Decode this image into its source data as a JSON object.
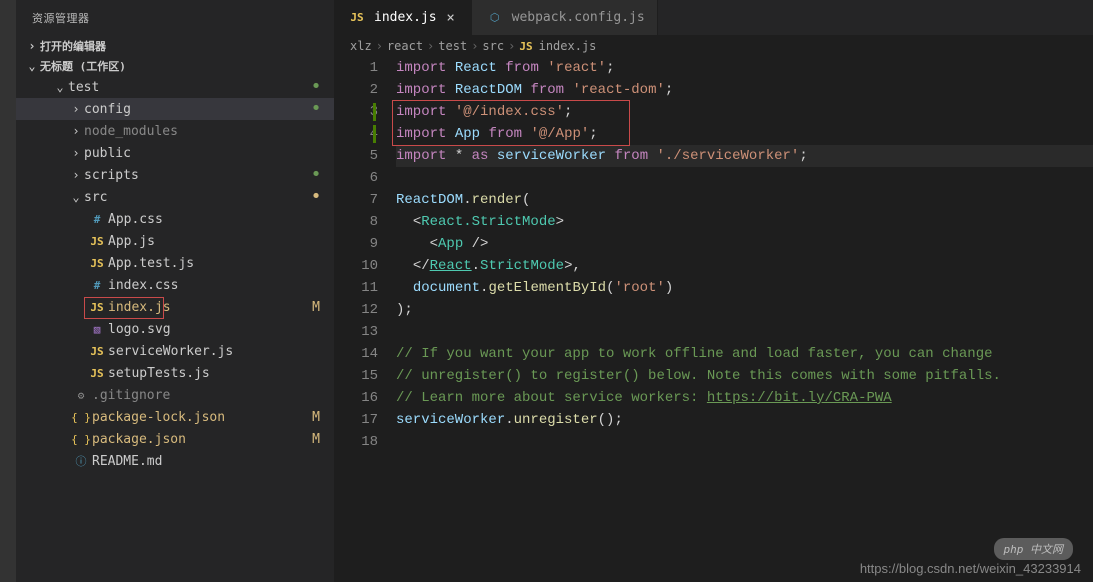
{
  "sidebar": {
    "title": "资源管理器",
    "sections": {
      "openEditors": "打开的编辑器",
      "workspace": "无标题 (工作区)"
    },
    "tree": {
      "root": "test",
      "folders": {
        "config": "config",
        "node_modules": "node_modules",
        "public": "public",
        "scripts": "scripts",
        "src": "src"
      },
      "srcFiles": {
        "appCss": "App.css",
        "appJs": "App.js",
        "appTestJs": "App.test.js",
        "indexCss": "index.css",
        "indexJs": "index.js",
        "logoSvg": "logo.svg",
        "serviceWorkerJs": "serviceWorker.js",
        "setupTestsJs": "setupTests.js"
      },
      "rootFiles": {
        "gitignore": ".gitignore",
        "packageLock": "package-lock.json",
        "packageJson": "package.json",
        "readme": "README.md"
      },
      "badges": {
        "modified": "M"
      }
    }
  },
  "tabs": {
    "indexJs": "index.js",
    "webpackConfig": "webpack.config.js"
  },
  "breadcrumbs": {
    "parts": [
      "xlz",
      "react",
      "test",
      "src",
      "index.js"
    ],
    "sep": "›"
  },
  "code": {
    "l1": {
      "kw1": "import",
      "var1": "React",
      "kw2": "from",
      "str": "'react'",
      "p": ";"
    },
    "l2": {
      "kw1": "import",
      "var1": "ReactDOM",
      "kw2": "from",
      "str": "'react-dom'",
      "p": ";"
    },
    "l3": {
      "kw1": "import",
      "str": "'@/index.css'",
      "p": ";"
    },
    "l4": {
      "kw1": "import",
      "var1": "App",
      "kw2": "from",
      "str": "'@/App'",
      "p": ";"
    },
    "l5": {
      "kw1": "import",
      "star": "*",
      "kw2": "as",
      "var1": "serviceWorker",
      "kw3": "from",
      "str": "'./serviceWorker'",
      "p": ";"
    },
    "l7": {
      "var1": "ReactDOM",
      "fn": "render",
      "p1": ".",
      "p2": "("
    },
    "l8": {
      "p1": "<",
      "tag": "React.StrictMode",
      "p2": ">"
    },
    "l9": {
      "p1": "<",
      "tag": "App",
      "p2": " />"
    },
    "l10": {
      "p1": "</",
      "tag": "React",
      "dot": ".",
      "tag2": "StrictMode",
      "p2": ">,",
      "underline": "React"
    },
    "l11": {
      "var1": "document",
      "fn": "getElementById",
      "str": "'root'",
      "p1": ".",
      "p2": "(",
      "p3": ")"
    },
    "l12": {
      "p": ");"
    },
    "l14": {
      "c": "// If you want your app to work offline and load faster, you can change"
    },
    "l15": {
      "c": "// unregister() to register() below. Note this comes with some pitfalls."
    },
    "l16": {
      "c": "// Learn more about service workers: ",
      "link": "https://bit.ly/CRA-PWA"
    },
    "l17": {
      "var1": "serviceWorker",
      "fn": "unregister",
      "p1": ".",
      "p2": "();"
    }
  },
  "icons": {
    "js": "JS",
    "css": "#",
    "json": "{ }",
    "svg": "▧",
    "git": "⚙",
    "readme": "ⓘ",
    "webpack": "⬡"
  },
  "watermark": "https://blog.csdn.net/weixin_43233914",
  "phpBadge": "php 中文网"
}
